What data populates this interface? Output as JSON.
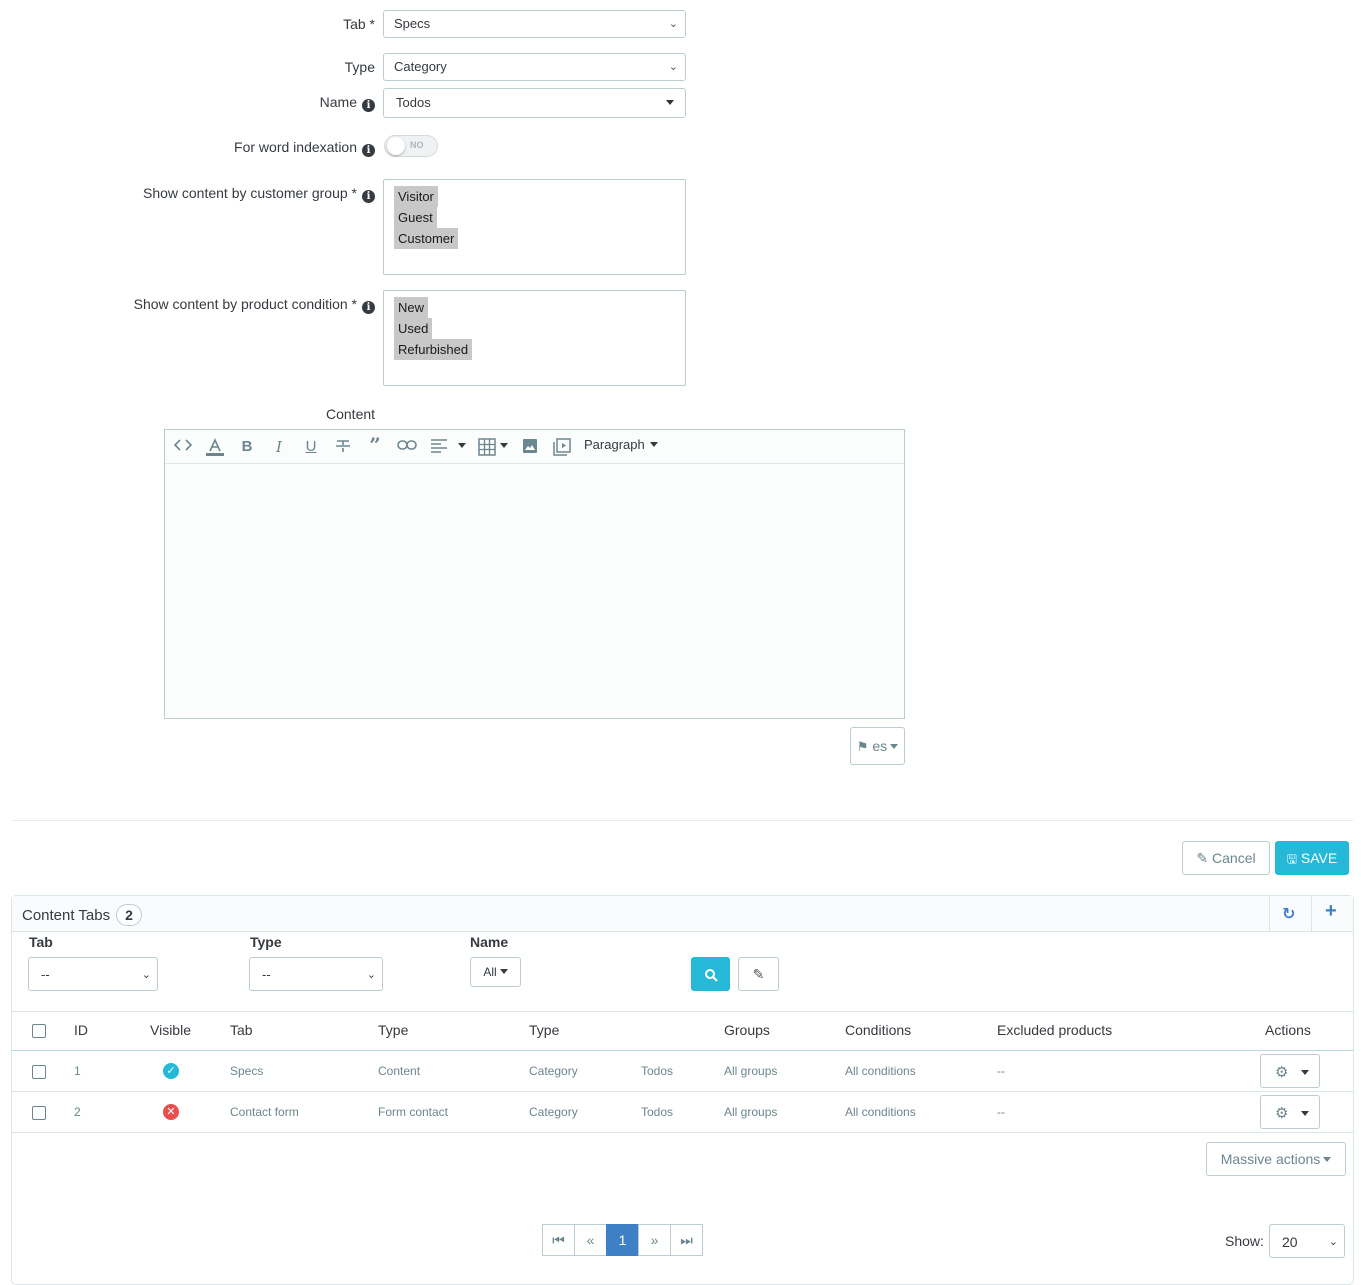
{
  "form": {
    "tab": {
      "label": "Tab *",
      "value": "Specs"
    },
    "type": {
      "label": "Type",
      "value": "Category"
    },
    "name": {
      "label": "Name",
      "value": "Todos"
    },
    "word_indexation": {
      "label": "For word indexation",
      "state": "NO"
    },
    "customer_group": {
      "label": "Show content by customer group *",
      "options": [
        "Visitor",
        "Guest",
        "Customer"
      ]
    },
    "product_condition": {
      "label": "Show content by product condition *",
      "options": [
        "New",
        "Used",
        "Refurbished"
      ]
    },
    "content": {
      "label": "Content",
      "format": "Paragraph",
      "language": "es"
    }
  },
  "buttons": {
    "cancel": "Cancel",
    "save": "SAVE"
  },
  "panel": {
    "title": "Content Tabs",
    "count": "2",
    "filters": {
      "tab_label": "Tab",
      "tab_value": "--",
      "type_label": "Type",
      "type_value": "--",
      "name_label": "Name",
      "name_value": "All"
    },
    "columns": [
      "ID",
      "Visible",
      "Tab",
      "Type",
      "Type",
      "Groups",
      "Conditions",
      "Excluded products",
      "Actions"
    ],
    "rows": [
      {
        "id": "1",
        "visible": true,
        "tab": "Specs",
        "type": "Content",
        "type2": "Category",
        "name": "Todos",
        "groups": "All groups",
        "conditions": "All conditions",
        "excluded": "--"
      },
      {
        "id": "2",
        "visible": false,
        "tab": "Contact form",
        "type": "Form contact",
        "type2": "Category",
        "name": "Todos",
        "groups": "All groups",
        "conditions": "All conditions",
        "excluded": "--"
      }
    ],
    "massive_actions": "Massive actions",
    "pagination": {
      "current": "1",
      "show_label": "Show:",
      "per_page": "20"
    }
  },
  "colors": {
    "primary": "#25b9d7",
    "page_active": "#3e80c6",
    "visible_ok": "#4cbb6c",
    "visible_no": "#e84e4e"
  }
}
